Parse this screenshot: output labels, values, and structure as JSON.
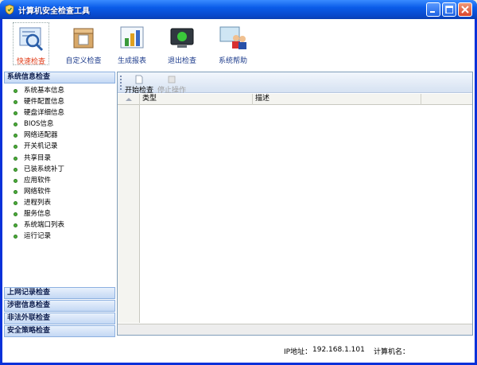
{
  "window": {
    "title": "计算机安全检查工具"
  },
  "toolbar": {
    "items": [
      {
        "label": "快速检查",
        "active": true
      },
      {
        "label": "自定义检查",
        "active": false
      },
      {
        "label": "生成报表",
        "active": false
      },
      {
        "label": "退出检查",
        "active": false
      },
      {
        "label": "系统帮助",
        "active": false
      }
    ]
  },
  "sidebar": {
    "group_system": "系统信息检查",
    "items": [
      "系统基本信息",
      "硬件配置信息",
      "硬盘详细信息",
      "BIOS信息",
      "网络适配器",
      "开关机记录",
      "共享目录",
      "已装系统补丁",
      "应用软件",
      "网络软件",
      "进程列表",
      "服务信息",
      "系统端口列表",
      "运行记录"
    ],
    "group_web": "上网记录检查",
    "group_secret": "涉密信息检查",
    "group_external": "非法外联检查",
    "group_policy": "安全策略检查"
  },
  "panel": {
    "start_label": "开始检查",
    "stop_label": "停止操作",
    "col_type": "类型",
    "col_desc": "描述"
  },
  "status": {
    "ip_label": "IP地址：",
    "ip_value": "192.168.1.101",
    "host_label": "计算机名："
  },
  "colors": {
    "title_bar": "#0A5BE8",
    "active_label": "#E03A16",
    "bullet": "#4CAF3A"
  }
}
